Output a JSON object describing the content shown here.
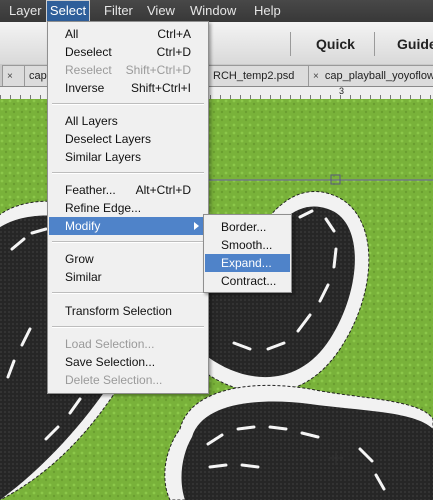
{
  "menubar": {
    "items": [
      "Layer",
      "Select",
      "Filter",
      "View",
      "Window",
      "Help"
    ],
    "active": "Select"
  },
  "toolbar": {
    "modes": [
      "Quick",
      "Guide"
    ]
  },
  "tabs": [
    {
      "close": "×",
      "label": "cap"
    },
    {
      "close": "×",
      "label": "cap"
    },
    {
      "close": "",
      "label": "RCH_temp2.psd"
    },
    {
      "close": "×",
      "label": "cap_playball_yoyoflow"
    }
  ],
  "ruler": {
    "label": "3"
  },
  "select_menu": {
    "groups": [
      [
        {
          "label": "All",
          "shortcut": "Ctrl+A",
          "disabled": false
        },
        {
          "label": "Deselect",
          "shortcut": "Ctrl+D",
          "disabled": false
        },
        {
          "label": "Reselect",
          "shortcut": "Shift+Ctrl+D",
          "disabled": true
        },
        {
          "label": "Inverse",
          "shortcut": "Shift+Ctrl+I",
          "disabled": false
        }
      ],
      [
        {
          "label": "All Layers",
          "shortcut": "",
          "disabled": false
        },
        {
          "label": "Deselect Layers",
          "shortcut": "",
          "disabled": false
        },
        {
          "label": "Similar Layers",
          "shortcut": "",
          "disabled": false
        }
      ],
      [
        {
          "label": "Feather...",
          "shortcut": "Alt+Ctrl+D",
          "disabled": false
        },
        {
          "label": "Refine Edge...",
          "shortcut": "",
          "disabled": false
        },
        {
          "label": "Modify",
          "shortcut": "",
          "disabled": false,
          "submenu": true,
          "highlighted": true
        }
      ],
      [
        {
          "label": "Grow",
          "shortcut": "",
          "disabled": false
        },
        {
          "label": "Similar",
          "shortcut": "",
          "disabled": false
        }
      ],
      [
        {
          "label": "Transform Selection",
          "shortcut": "",
          "disabled": false
        }
      ],
      [
        {
          "label": "Load Selection...",
          "shortcut": "",
          "disabled": true
        },
        {
          "label": "Save Selection...",
          "shortcut": "",
          "disabled": false
        },
        {
          "label": "Delete Selection...",
          "shortcut": "",
          "disabled": true
        }
      ]
    ]
  },
  "modify_submenu": {
    "items": [
      {
        "label": "Border...",
        "highlighted": false
      },
      {
        "label": "Smooth...",
        "highlighted": false
      },
      {
        "label": "Expand...",
        "highlighted": true
      },
      {
        "label": "Contract...",
        "highlighted": false
      }
    ]
  },
  "colors": {
    "menu_highlight": "#4f83c9",
    "active_menu": "#2f5f9a",
    "grass": "#79b23a",
    "patch": "#2a2a2a"
  }
}
